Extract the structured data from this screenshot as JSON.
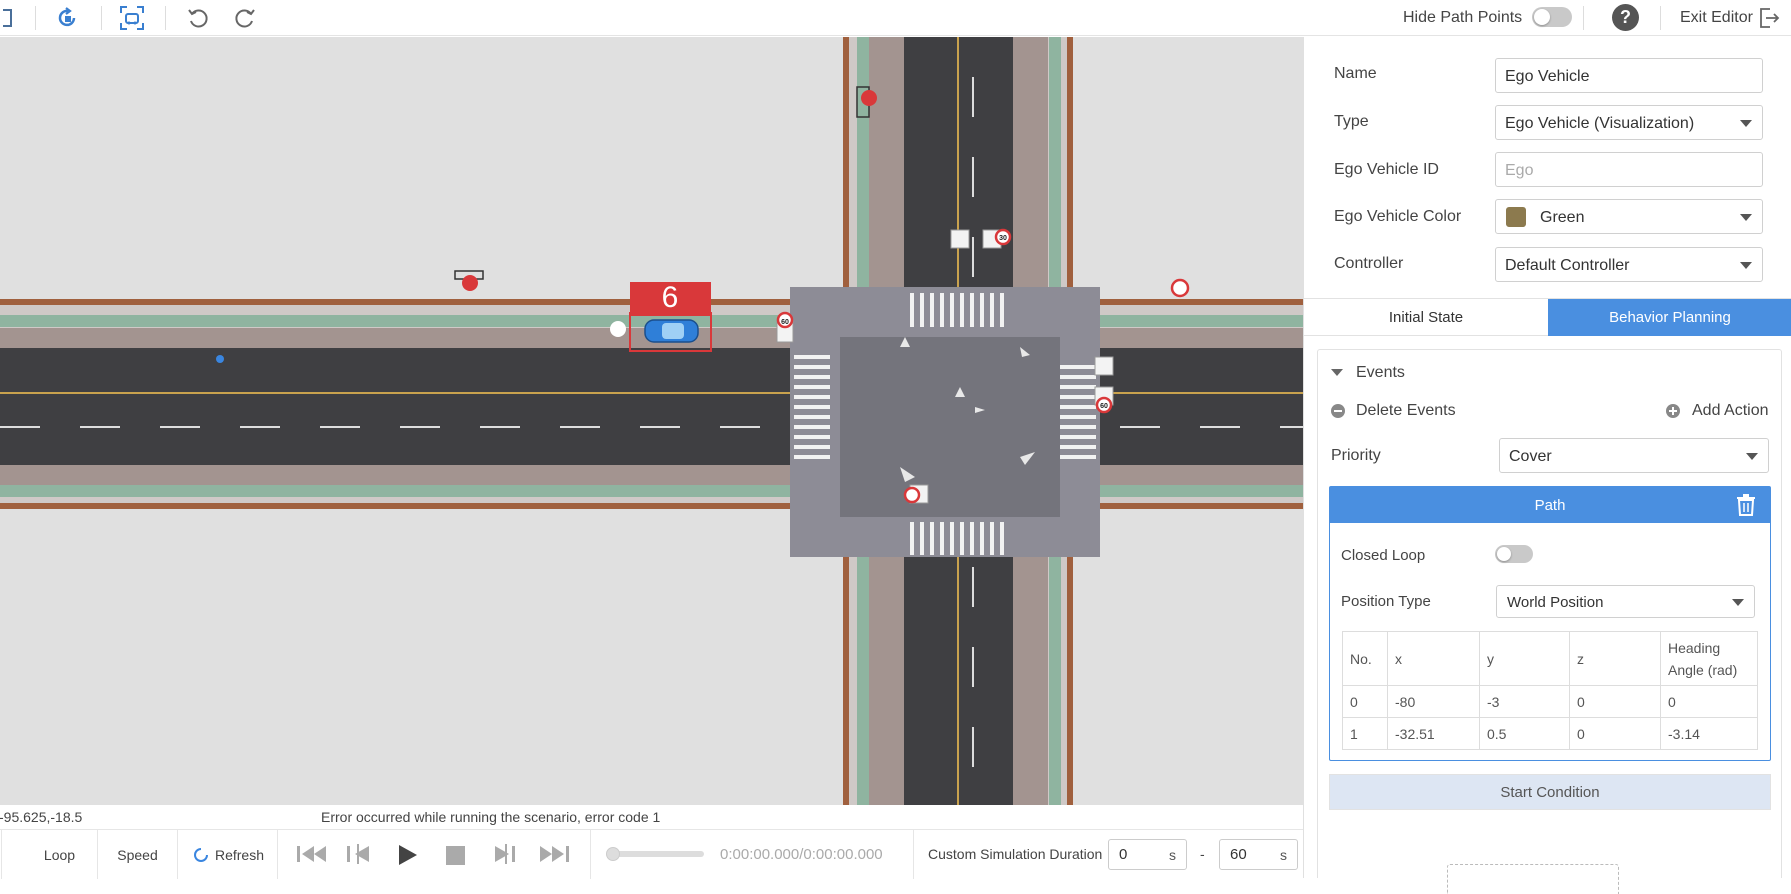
{
  "toolbar": {
    "hide_path_points_label": "Hide Path Points",
    "hide_path_points_on": false,
    "help_label": "?",
    "exit_editor_label": "Exit Editor",
    "icons": [
      "partial-icon",
      "rotate-vehicle-icon",
      "focus-vehicle-icon",
      "undo-icon",
      "redo-icon",
      "exit-icon"
    ]
  },
  "map": {
    "selected_vehicle_number": "6",
    "speed_limit_sign_left": "60",
    "speed_limit_sign_top": "30",
    "speed_limit_sign_right": "60"
  },
  "status": {
    "coordinates": "-95.625,-18.5",
    "error_message": "Error occurred while running the scenario, error code 1"
  },
  "playback": {
    "loop_label": "Loop",
    "speed_label": "Speed",
    "refresh_label": "Refresh",
    "time_display": "0:00:00.000/0:00:00.000",
    "custom_duration_label": "Custom Simulation Duration",
    "start_value": "0",
    "end_value": "60",
    "unit": "s",
    "separator": "-"
  },
  "panel": {
    "name_label": "Name",
    "name_value": "Ego Vehicle",
    "type_label": "Type",
    "type_value": "Ego Vehicle (Visualization)",
    "ego_id_label": "Ego Vehicle ID",
    "ego_id_placeholder": "Ego",
    "color_label": "Ego Vehicle Color",
    "color_value": "Green",
    "color_swatch": "#8c7a4e",
    "controller_label": "Controller",
    "controller_value": "Default Controller",
    "tabs": [
      {
        "label": "Initial State",
        "active": false
      },
      {
        "label": "Behavior Planning",
        "active": true
      }
    ],
    "events_label": "Events",
    "delete_events_label": "Delete Events",
    "add_action_label": "Add Action",
    "priority_label": "Priority",
    "priority_value": "Cover",
    "path": {
      "title": "Path",
      "closed_loop_label": "Closed Loop",
      "closed_loop_on": false,
      "position_type_label": "Position Type",
      "position_type_value": "World Position",
      "columns": [
        "No.",
        "x",
        "y",
        "z",
        "Heading Angle (rad)"
      ],
      "rows": [
        [
          "0",
          "-80",
          "-3",
          "0",
          "0"
        ],
        [
          "1",
          "-32.51",
          "0.5",
          "0",
          "-3.14"
        ]
      ]
    },
    "start_condition_label": "Start Condition"
  },
  "colors": {
    "accent": "#4a8fe0",
    "error_box": "#d9383a",
    "asphalt": "#3f3f42",
    "sidewalk": "#a39490",
    "grass": "#8fb4a0",
    "curb_outer": "#a0603e"
  }
}
